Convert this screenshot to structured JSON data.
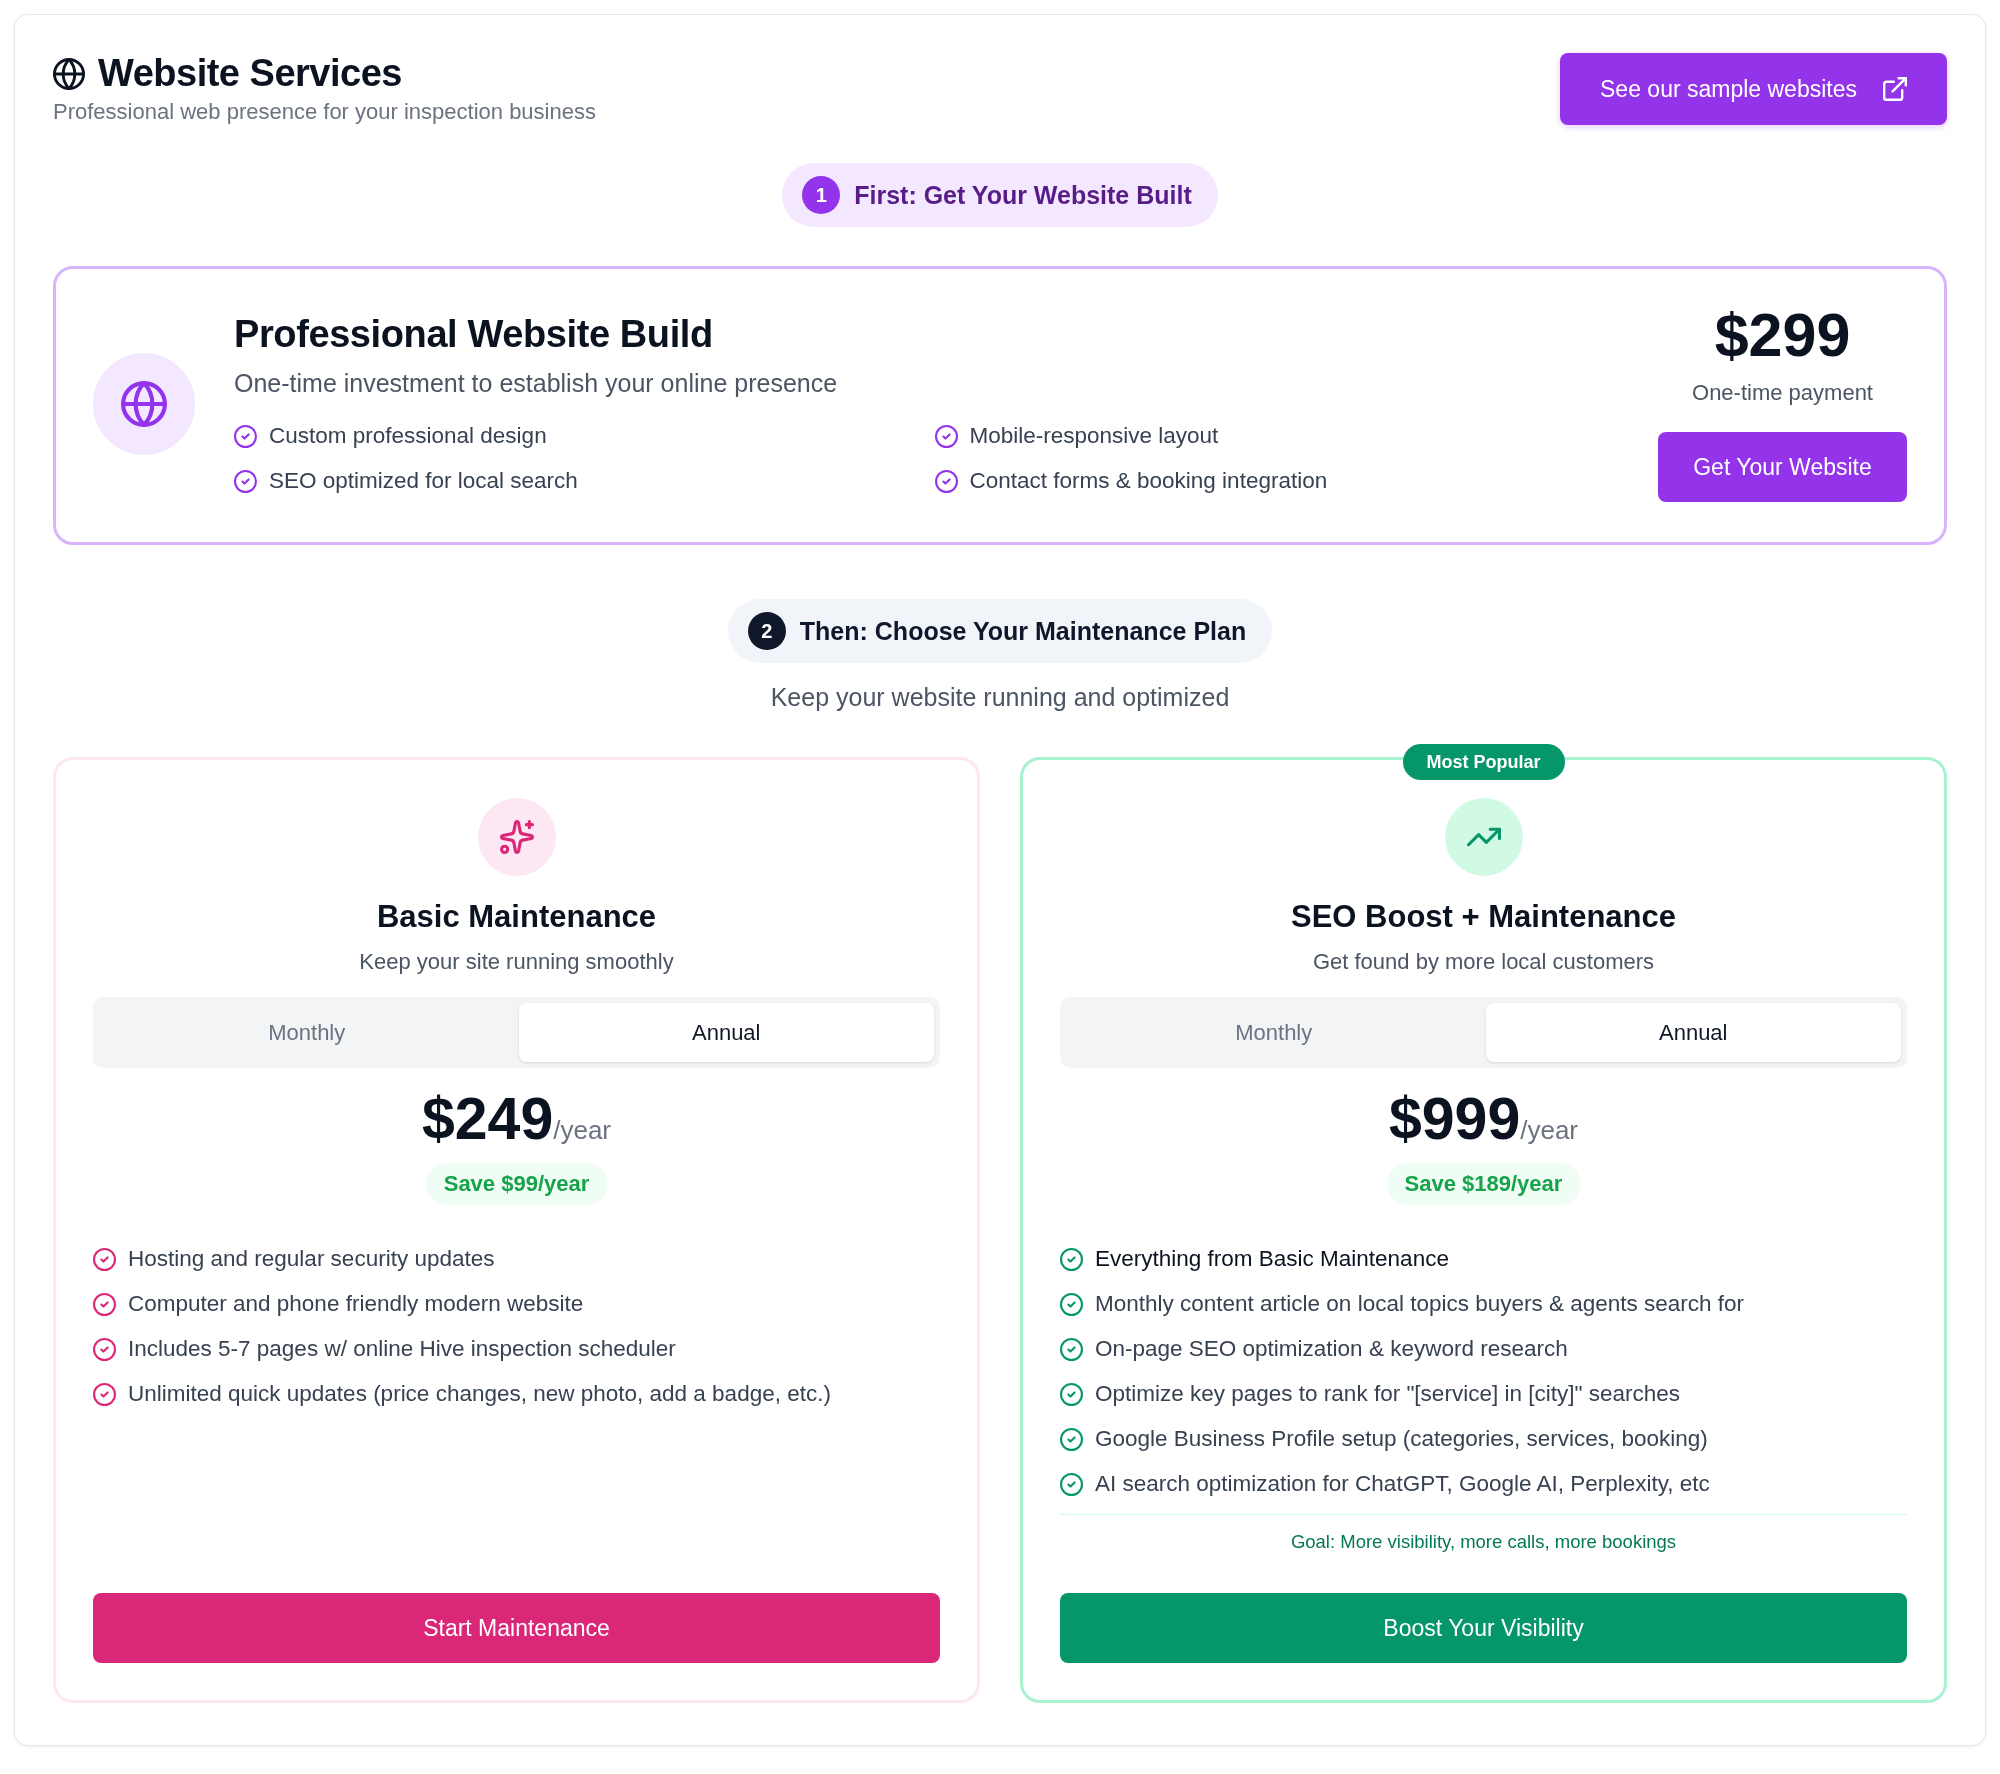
{
  "header": {
    "title": "Website Services",
    "subtitle": "Professional web presence for your inspection business",
    "link_button": "See our sample websites"
  },
  "step_one": {
    "number": "1",
    "label": "First: Get Your Website Built"
  },
  "build": {
    "title": "Professional Website Build",
    "subtitle": "One-time investment to establish your online presence",
    "features": [
      "Custom professional design",
      "Mobile-responsive layout",
      "SEO optimized for local search",
      "Contact forms & booking integration"
    ],
    "price": "$299",
    "price_note": "One-time payment",
    "button": "Get Your Website"
  },
  "step_two": {
    "number": "2",
    "label": "Then: Choose Your Maintenance Plan",
    "subtitle": "Keep your website running and optimized"
  },
  "plans": [
    {
      "kind": "basic",
      "color": "#db2777",
      "title": "Basic Maintenance",
      "subtitle": "Keep your site running smoothly",
      "billing": [
        {
          "label": "Monthly",
          "selected": false
        },
        {
          "label": "Annual",
          "selected": true
        }
      ],
      "price": "$249",
      "period": "/year",
      "savings": "Save $99/year",
      "features": [
        {
          "text": "Hosting and regular security updates",
          "highlighted": false
        },
        {
          "text": "Computer and phone friendly modern website",
          "highlighted": false
        },
        {
          "text": "Includes 5-7 pages w/ online Hive inspection scheduler",
          "highlighted": false
        },
        {
          "text": "Unlimited quick updates (price changes, new photo, add a badge, etc.)",
          "highlighted": false
        }
      ],
      "button": "Start Maintenance"
    },
    {
      "kind": "boost",
      "color": "#059669",
      "badge": "Most Popular",
      "title": "SEO Boost + Maintenance",
      "subtitle": "Get found by more local customers",
      "billing": [
        {
          "label": "Monthly",
          "selected": false
        },
        {
          "label": "Annual",
          "selected": true
        }
      ],
      "price": "$999",
      "period": "/year",
      "savings": "Save $189/year",
      "features": [
        {
          "text": "Everything from Basic Maintenance",
          "highlighted": true
        },
        {
          "text": "Monthly content article on local topics buyers & agents search for",
          "highlighted": false
        },
        {
          "text": "On-page SEO optimization & keyword research",
          "highlighted": false
        },
        {
          "text": "Optimize key pages to rank for \"[service] in [city]\" searches",
          "highlighted": false
        },
        {
          "text": "Google Business Profile setup (categories, services, booking)",
          "highlighted": false
        },
        {
          "text": "AI search optimization for ChatGPT, Google AI, Perplexity, etc",
          "highlighted": false
        }
      ],
      "goal": "Goal: More visibility, more calls, more bookings",
      "button": "Boost Your Visibility"
    }
  ]
}
